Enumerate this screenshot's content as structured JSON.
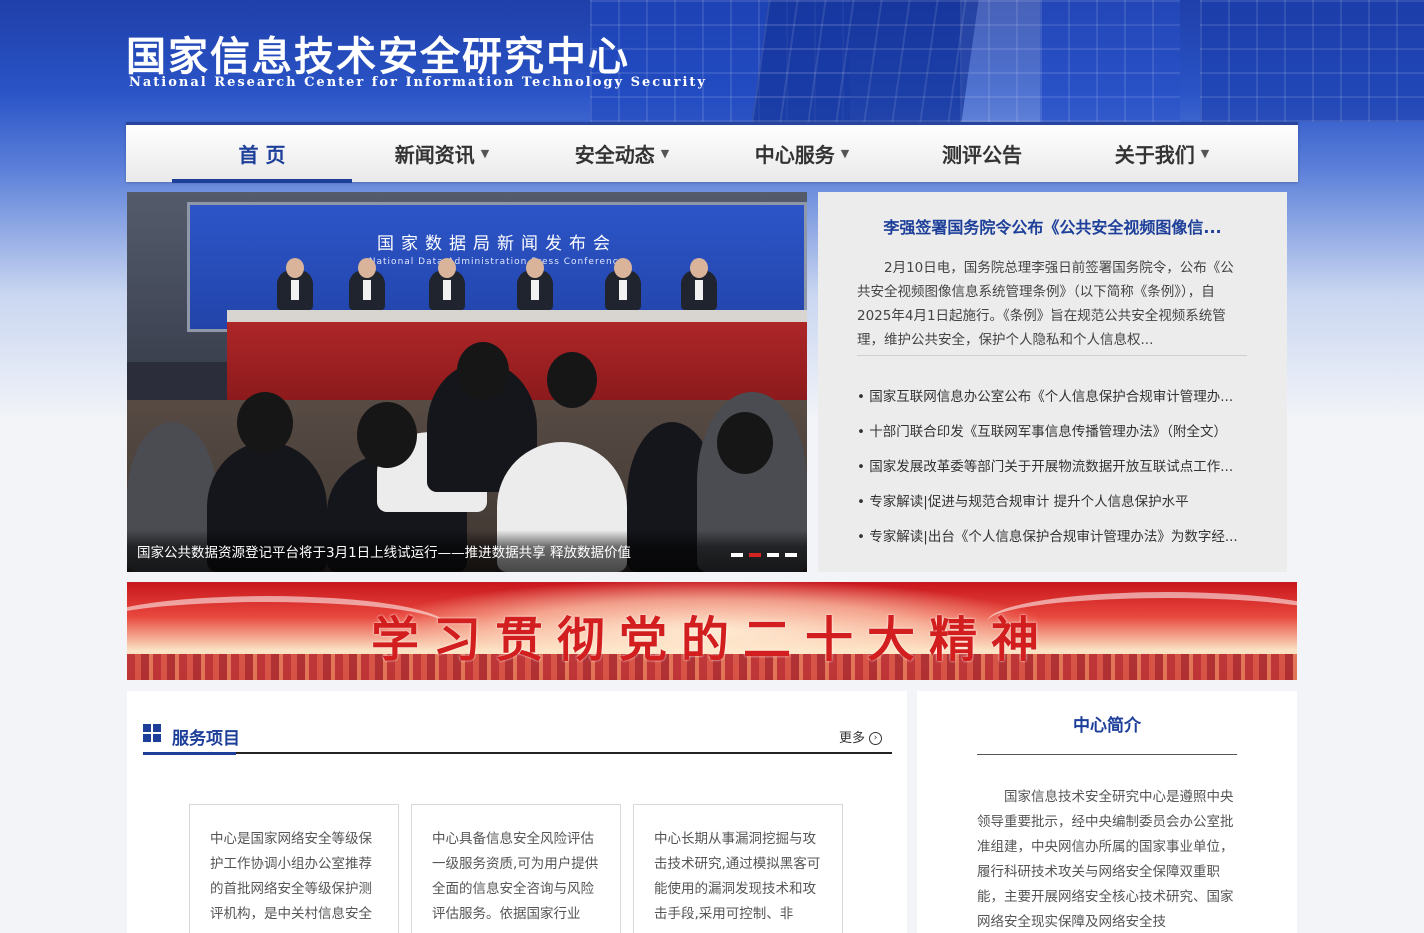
{
  "header": {
    "title_cn": "国家信息技术安全研究中心",
    "title_en": "National Research Center for Information Technology Security"
  },
  "nav": {
    "items": [
      {
        "label": "首 页",
        "has_dropdown": false,
        "active": true
      },
      {
        "label": "新闻资讯",
        "has_dropdown": true,
        "active": false
      },
      {
        "label": "安全动态",
        "has_dropdown": true,
        "active": false
      },
      {
        "label": "中心服务",
        "has_dropdown": true,
        "active": false
      },
      {
        "label": "测评公告",
        "has_dropdown": false,
        "active": false
      },
      {
        "label": "关于我们",
        "has_dropdown": true,
        "active": false
      }
    ]
  },
  "slider": {
    "screen_title": "国家数据局新闻发布会",
    "screen_subtitle": "National Data Administration Press Conference",
    "caption": "国家公共数据资源登记平台将于3月1日上线试运行——推进数据共享 释放数据价值",
    "active_slide": 2,
    "slide_count": 4
  },
  "news": {
    "headline": "李强签署国务院令公布《公共安全视频图像信...",
    "summary": "2月10日电，国务院总理李强日前签署国务院令，公布《公共安全视频图像信息系统管理条例》（以下简称《条例》），自2025年4月1日起施行。《条例》旨在规范公共安全视频系统管理，维护公共安全，保护个人隐私和个人信息权...",
    "items": [
      "国家互联网信息办公室公布《个人信息保护合规审计管理办...",
      "十部门联合印发《互联网军事信息传播管理办法》（附全文）",
      "国家发展改革委等部门关于开展物流数据开放互联试点工作...",
      "专家解读|促进与规范合规审计 提升个人信息保护水平",
      "专家解读|出台《个人信息保护合规审计管理办法》为数字经..."
    ]
  },
  "banner": {
    "text": "学习贯彻党的二十大精神"
  },
  "services": {
    "title": "服务项目",
    "more": "更多",
    "cards": [
      "中心是国家网络安全等级保护工作协调小组办公室推荐的首批网络安全等级保护测评机构，是中关村信息安全",
      "中心具备信息安全风险评估一级服务资质,可为用户提供全面的信息安全咨询与风险评估服务。依据国家行业",
      "中心长期从事漏洞挖掘与攻击技术研究,通过模拟黑客可能使用的漏洞发现技术和攻击手段,采用可控制、非"
    ]
  },
  "intro": {
    "title": "中心简介",
    "body": "国家信息技术安全研究中心是遵照中央领导重要批示，经中央编制委员会办公室批准组建，中央网信办所属的国家事业单位，履行科研技术攻关与网络安全保障双重职能，主要开展网络安全核心技术研究、国家网络安全现实保障及网络安全技"
  }
}
